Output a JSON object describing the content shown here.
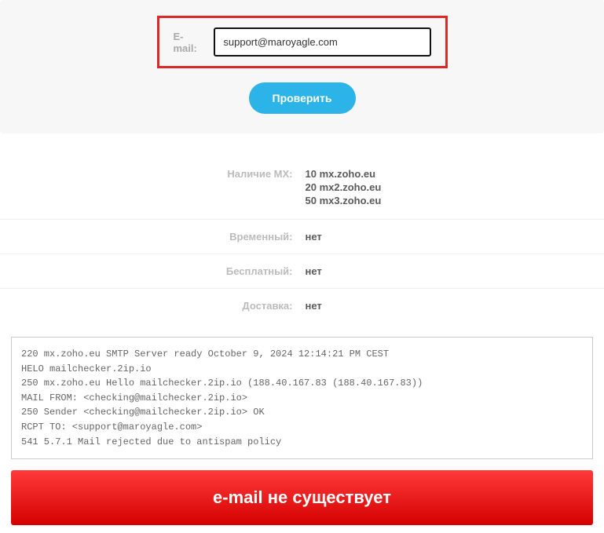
{
  "form": {
    "label": "E-mail:",
    "value": "support@maroyagle.com",
    "button": "Проверить"
  },
  "results": {
    "mx": {
      "label": "Наличие MX:",
      "records": [
        {
          "priority": "10",
          "host": "mx.zoho.eu"
        },
        {
          "priority": "20",
          "host": "mx2.zoho.eu"
        },
        {
          "priority": "50",
          "host": "mx3.zoho.eu"
        }
      ]
    },
    "disposable": {
      "label": "Временный:",
      "value": "нет"
    },
    "free": {
      "label": "Бесплатный:",
      "value": "нет"
    },
    "delivery": {
      "label": "Доставка:",
      "value": "нет"
    }
  },
  "log": [
    "220 mx.zoho.eu SMTP Server ready October 9, 2024 12:14:21 PM CEST",
    "HELO mailchecker.2ip.io",
    "250 mx.zoho.eu Hello mailchecker.2ip.io (188.40.167.83 (188.40.167.83))",
    "MAIL FROM: <checking@mailchecker.2ip.io>",
    "250 Sender <checking@mailchecker.2ip.io> OK",
    "RCPT TO: <support@maroyagle.com>",
    "541 5.7.1 Mail rejected due to antispam policy"
  ],
  "status": "e-mail не существует"
}
